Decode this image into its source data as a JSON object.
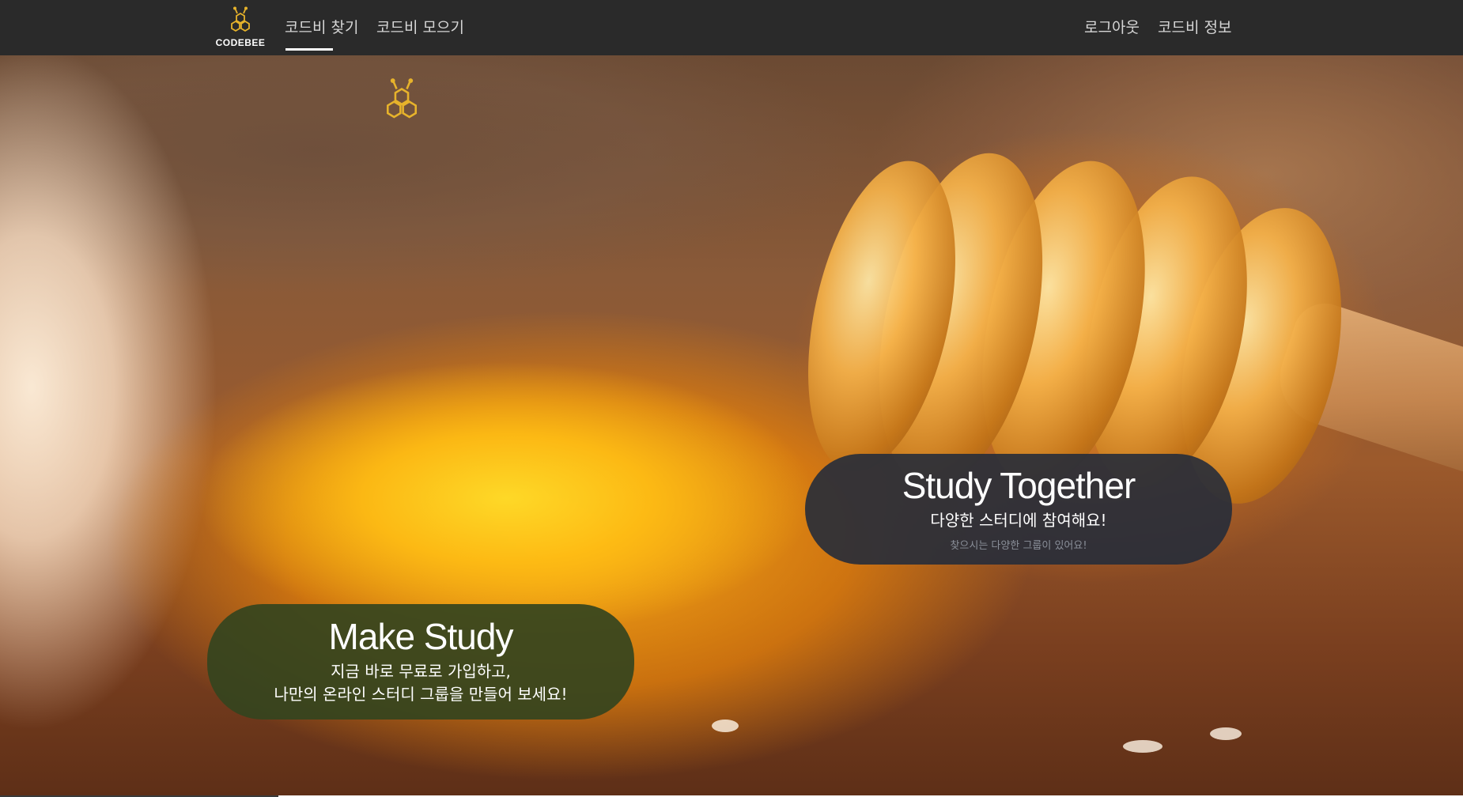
{
  "nav": {
    "brand": "CODEBEE",
    "links": [
      {
        "label": "코드비 찾기",
        "active": true
      },
      {
        "label": "코드비 모으기",
        "active": false
      }
    ],
    "right_links": [
      {
        "label": "로그아웃"
      },
      {
        "label": "코드비 정보"
      }
    ]
  },
  "hero": {
    "together": {
      "title": "Study Together",
      "subtitle": "다양한 스터디에 참여해요!",
      "small": "찾으시는 다양한 그룹이 있어요!"
    },
    "make": {
      "title": "Make Study",
      "line1": "지금 바로 무료로 가입하고,",
      "line2": "나만의 온라인 스터디 그룹을 만들어 보세요!"
    }
  },
  "colors": {
    "navbar": "#2a2a2a",
    "logo_gold": "#e7b32b",
    "together_pill": "#262c3a",
    "make_pill": "#34441e"
  },
  "icons": {
    "brand_logo": "honeycomb-bee-icon",
    "hero_mark": "honeycomb-bee-icon"
  }
}
